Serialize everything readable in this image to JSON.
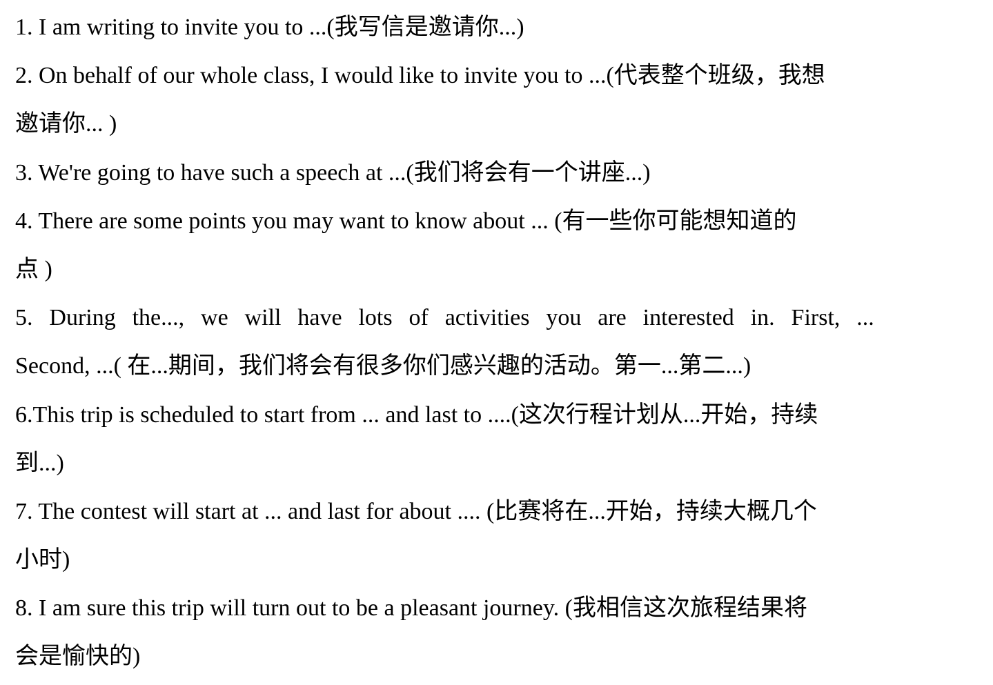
{
  "document": {
    "items": [
      {
        "lines": [
          "1. I am writing to invite you to ...(我写信是邀请你...)"
        ]
      },
      {
        "lines": [
          "2. On behalf of our whole class, I would like to invite you to ...(代表整个班级，我想",
          "邀请你... )"
        ]
      },
      {
        "lines": [
          "3. We're going to have such a speech at ...(我们将会有一个讲座...)"
        ]
      },
      {
        "lines": [
          "4. There are some points you may want to know about ... (有一些你可能想知道的",
          "点 )"
        ]
      },
      {
        "lines": [
          "5. During the..., we will have lots of activities you are interested in. First, ...",
          "Second, ...( 在...期间，我们将会有很多你们感兴趣的活动。第一...第二...)"
        ]
      },
      {
        "lines": [
          "6.This trip is scheduled to start from ... and last to ....(这次行程计划从...开始，持续",
          "到...)"
        ]
      },
      {
        "lines": [
          "7. The contest will start at ... and last for about .... (比赛将在...开始，持续大概几个",
          "小时)"
        ]
      },
      {
        "lines": [
          "8. I am sure this trip will turn out to be a pleasant journey. (我相信这次旅程结果将",
          "会是愉快的)"
        ]
      }
    ]
  }
}
